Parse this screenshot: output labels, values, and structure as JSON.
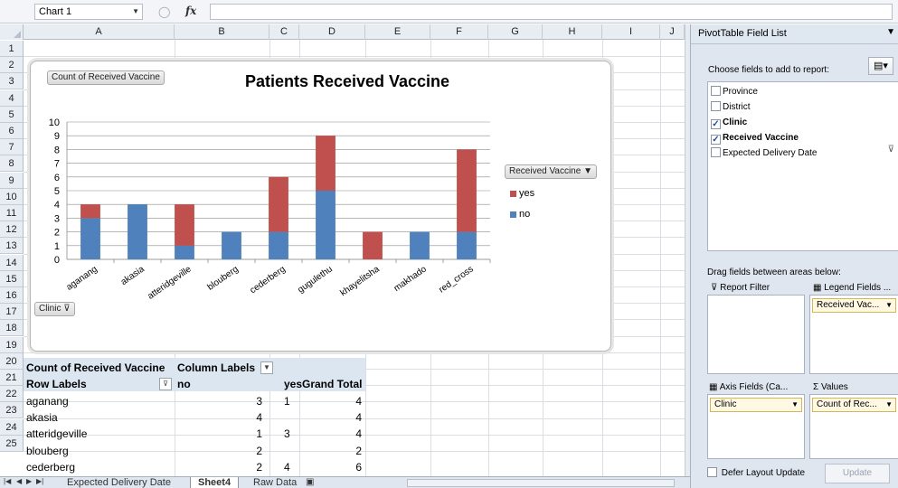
{
  "formula_bar": {
    "name_box": "Chart 1",
    "fx": "fx",
    "formula": ""
  },
  "columns": [
    "A",
    "B",
    "C",
    "D",
    "E",
    "F",
    "G",
    "H",
    "I",
    "J"
  ],
  "rows": [
    "1",
    "2",
    "3",
    "4",
    "5",
    "6",
    "7",
    "8",
    "9",
    "10",
    "11",
    "12",
    "13",
    "14",
    "15",
    "16",
    "17",
    "18",
    "19",
    "20",
    "21",
    "22",
    "23",
    "24",
    "25"
  ],
  "pivot": {
    "header_value": "Count of Received Vaccine",
    "column_labels": "Column Labels",
    "row_labels": "Row Labels",
    "col_no": "no",
    "col_yes": "yes",
    "col_total": "Grand Total",
    "rows": [
      {
        "label": "aganang",
        "no": "3",
        "yes": "1",
        "total": "4"
      },
      {
        "label": "akasia",
        "no": "4",
        "yes": "",
        "total": "4"
      },
      {
        "label": "atteridgeville",
        "no": "1",
        "yes": "3",
        "total": "4"
      },
      {
        "label": "blouberg",
        "no": "2",
        "yes": "",
        "total": "2"
      },
      {
        "label": "cederberg",
        "no": "2",
        "yes": "4",
        "total": "6"
      }
    ]
  },
  "chart": {
    "value_button": "Count of Received Vaccine",
    "axis_button": "Clinic",
    "legend_button": "Received Vaccine",
    "colors": {
      "yes": "#c0504d",
      "no": "#4f81bd"
    }
  },
  "chart_data": {
    "type": "bar",
    "stacked": true,
    "title": "Patients Received Vaccine",
    "categories": [
      "aganang",
      "akasia",
      "atteridgeville",
      "blouberg",
      "cederberg",
      "gugulethu",
      "khayelitsha",
      "makhado",
      "red_cross"
    ],
    "series": [
      {
        "name": "no",
        "values": [
          3,
          4,
          1,
          2,
          2,
          5,
          0,
          2,
          2
        ]
      },
      {
        "name": "yes",
        "values": [
          1,
          0,
          3,
          0,
          4,
          4,
          2,
          0,
          6
        ]
      }
    ],
    "ylim": [
      0,
      10
    ],
    "yticks": [
      "0",
      "1",
      "2",
      "3",
      "4",
      "5",
      "6",
      "7",
      "8",
      "9",
      "10"
    ],
    "grid": true,
    "legend_placement": "right"
  },
  "field_list": {
    "title": "PivotTable Field List",
    "choose_label": "Choose fields to add to report:",
    "fields": [
      {
        "label": "Province",
        "checked": false,
        "bold": false
      },
      {
        "label": "District",
        "checked": false,
        "bold": false
      },
      {
        "label": "Clinic",
        "checked": true,
        "bold": true
      },
      {
        "label": "Received Vaccine",
        "checked": true,
        "bold": true
      },
      {
        "label": "Expected Delivery Date",
        "checked": false,
        "bold": false
      }
    ],
    "drag_label": "Drag fields between areas below:",
    "report_filter": "Report Filter",
    "legend_fields": "Legend Fields ...",
    "legend_chip": "Received Vac...",
    "axis_fields": "Axis Fields (Ca...",
    "values_label": "Values",
    "axis_chip": "Clinic",
    "values_chip": "Count of Rec...",
    "defer_label": "Defer Layout Update",
    "update_label": "Update"
  },
  "sheet_tabs": {
    "tabs": [
      "Expected Delivery Date",
      "Sheet4",
      "Raw Data"
    ],
    "active": "Sheet4"
  }
}
